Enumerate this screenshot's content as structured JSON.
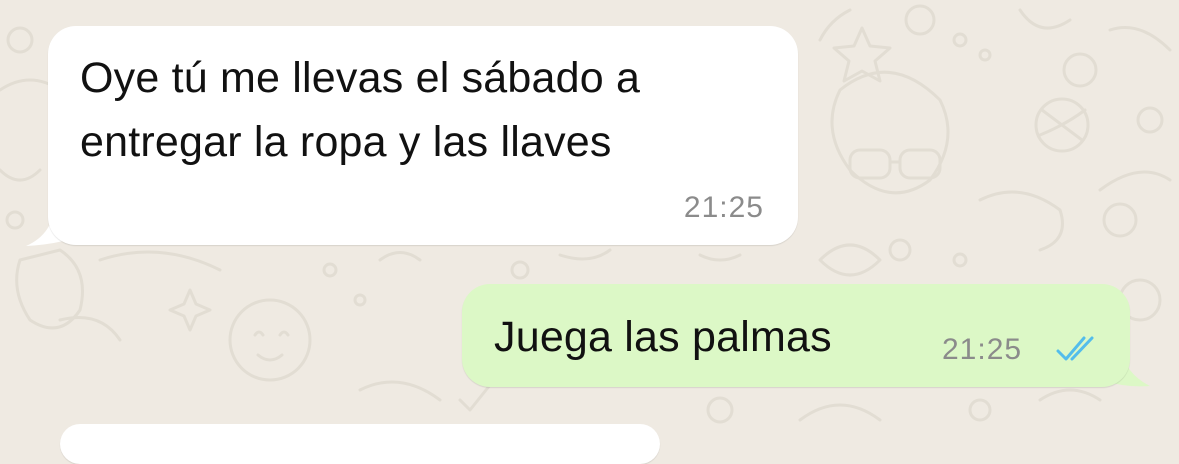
{
  "chat": {
    "messages": [
      {
        "direction": "incoming",
        "lines": [
          "Oye tú me llevas el sábado a",
          "entregar la ropa y las llaves"
        ],
        "time": "21:25"
      },
      {
        "direction": "outgoing",
        "text": "Juega las palmas",
        "time": "21:25",
        "status_icon": "double-check-read-icon"
      }
    ]
  },
  "colors": {
    "wallpaper": "#efeae2",
    "incoming_bubble": "#ffffff",
    "outgoing_bubble": "#dcf8c6",
    "read_ticks": "#53bdeb",
    "timestamp": "#8b8b8b"
  }
}
